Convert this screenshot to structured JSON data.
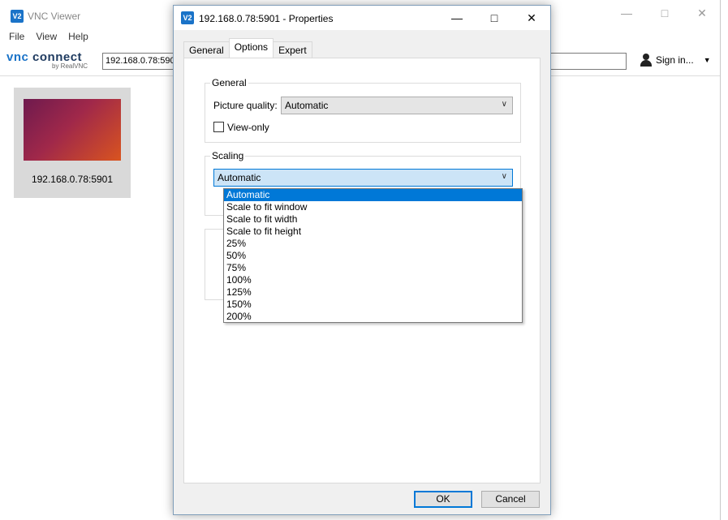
{
  "main_window": {
    "title": "VNC Viewer",
    "icon_text": "V2",
    "menu": [
      "File",
      "View",
      "Help"
    ],
    "logo_vnc": "vnc",
    "logo_connect": "connect",
    "logo_by": "by RealVNC",
    "address_value": "192.168.0.78:5901",
    "sign_in_label": "Sign in...",
    "thumbnail_label": "192.168.0.78:5901"
  },
  "dialog": {
    "title": "192.168.0.78:5901 - Properties",
    "icon_text": "V2",
    "tabs": [
      "General",
      "Options",
      "Expert"
    ],
    "active_tab": "Options",
    "general_group": {
      "title": "General",
      "picture_quality_label": "Picture quality:",
      "picture_quality_value": "Automatic",
      "view_only_label": "View-only",
      "view_only_checked": false
    },
    "scaling_group": {
      "title": "Scaling",
      "value": "Automatic"
    },
    "scaling_options": [
      "Automatic",
      "Scale to fit window",
      "Scale to fit width",
      "Scale to fit height",
      "25%",
      "50%",
      "75%",
      "100%",
      "125%",
      "150%",
      "200%"
    ],
    "scaling_selected": "Automatic",
    "ok_label": "OK",
    "cancel_label": "Cancel"
  },
  "colors": {
    "accent": "#0078d7",
    "selection_bg": "#cce4f7",
    "brand": "#1a73c8"
  }
}
